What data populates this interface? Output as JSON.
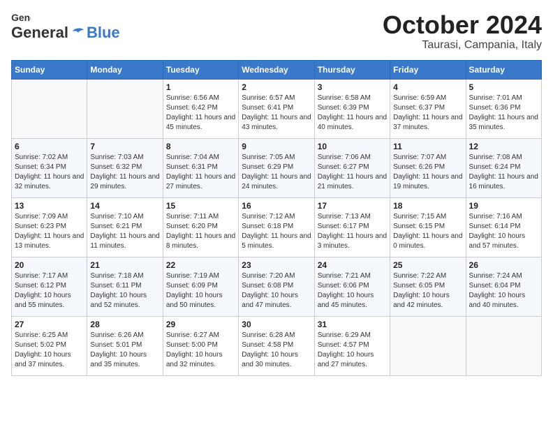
{
  "header": {
    "logo_general": "General",
    "logo_blue": "Blue",
    "month": "October 2024",
    "location": "Taurasi, Campania, Italy"
  },
  "weekdays": [
    "Sunday",
    "Monday",
    "Tuesday",
    "Wednesday",
    "Thursday",
    "Friday",
    "Saturday"
  ],
  "weeks": [
    [
      {
        "day": "",
        "details": ""
      },
      {
        "day": "",
        "details": ""
      },
      {
        "day": "1",
        "details": "Sunrise: 6:56 AM\nSunset: 6:42 PM\nDaylight: 11 hours and 45 minutes."
      },
      {
        "day": "2",
        "details": "Sunrise: 6:57 AM\nSunset: 6:41 PM\nDaylight: 11 hours and 43 minutes."
      },
      {
        "day": "3",
        "details": "Sunrise: 6:58 AM\nSunset: 6:39 PM\nDaylight: 11 hours and 40 minutes."
      },
      {
        "day": "4",
        "details": "Sunrise: 6:59 AM\nSunset: 6:37 PM\nDaylight: 11 hours and 37 minutes."
      },
      {
        "day": "5",
        "details": "Sunrise: 7:01 AM\nSunset: 6:36 PM\nDaylight: 11 hours and 35 minutes."
      }
    ],
    [
      {
        "day": "6",
        "details": "Sunrise: 7:02 AM\nSunset: 6:34 PM\nDaylight: 11 hours and 32 minutes."
      },
      {
        "day": "7",
        "details": "Sunrise: 7:03 AM\nSunset: 6:32 PM\nDaylight: 11 hours and 29 minutes."
      },
      {
        "day": "8",
        "details": "Sunrise: 7:04 AM\nSunset: 6:31 PM\nDaylight: 11 hours and 27 minutes."
      },
      {
        "day": "9",
        "details": "Sunrise: 7:05 AM\nSunset: 6:29 PM\nDaylight: 11 hours and 24 minutes."
      },
      {
        "day": "10",
        "details": "Sunrise: 7:06 AM\nSunset: 6:27 PM\nDaylight: 11 hours and 21 minutes."
      },
      {
        "day": "11",
        "details": "Sunrise: 7:07 AM\nSunset: 6:26 PM\nDaylight: 11 hours and 19 minutes."
      },
      {
        "day": "12",
        "details": "Sunrise: 7:08 AM\nSunset: 6:24 PM\nDaylight: 11 hours and 16 minutes."
      }
    ],
    [
      {
        "day": "13",
        "details": "Sunrise: 7:09 AM\nSunset: 6:23 PM\nDaylight: 11 hours and 13 minutes."
      },
      {
        "day": "14",
        "details": "Sunrise: 7:10 AM\nSunset: 6:21 PM\nDaylight: 11 hours and 11 minutes."
      },
      {
        "day": "15",
        "details": "Sunrise: 7:11 AM\nSunset: 6:20 PM\nDaylight: 11 hours and 8 minutes."
      },
      {
        "day": "16",
        "details": "Sunrise: 7:12 AM\nSunset: 6:18 PM\nDaylight: 11 hours and 5 minutes."
      },
      {
        "day": "17",
        "details": "Sunrise: 7:13 AM\nSunset: 6:17 PM\nDaylight: 11 hours and 3 minutes."
      },
      {
        "day": "18",
        "details": "Sunrise: 7:15 AM\nSunset: 6:15 PM\nDaylight: 11 hours and 0 minutes."
      },
      {
        "day": "19",
        "details": "Sunrise: 7:16 AM\nSunset: 6:14 PM\nDaylight: 10 hours and 57 minutes."
      }
    ],
    [
      {
        "day": "20",
        "details": "Sunrise: 7:17 AM\nSunset: 6:12 PM\nDaylight: 10 hours and 55 minutes."
      },
      {
        "day": "21",
        "details": "Sunrise: 7:18 AM\nSunset: 6:11 PM\nDaylight: 10 hours and 52 minutes."
      },
      {
        "day": "22",
        "details": "Sunrise: 7:19 AM\nSunset: 6:09 PM\nDaylight: 10 hours and 50 minutes."
      },
      {
        "day": "23",
        "details": "Sunrise: 7:20 AM\nSunset: 6:08 PM\nDaylight: 10 hours and 47 minutes."
      },
      {
        "day": "24",
        "details": "Sunrise: 7:21 AM\nSunset: 6:06 PM\nDaylight: 10 hours and 45 minutes."
      },
      {
        "day": "25",
        "details": "Sunrise: 7:22 AM\nSunset: 6:05 PM\nDaylight: 10 hours and 42 minutes."
      },
      {
        "day": "26",
        "details": "Sunrise: 7:24 AM\nSunset: 6:04 PM\nDaylight: 10 hours and 40 minutes."
      }
    ],
    [
      {
        "day": "27",
        "details": "Sunrise: 6:25 AM\nSunset: 5:02 PM\nDaylight: 10 hours and 37 minutes."
      },
      {
        "day": "28",
        "details": "Sunrise: 6:26 AM\nSunset: 5:01 PM\nDaylight: 10 hours and 35 minutes."
      },
      {
        "day": "29",
        "details": "Sunrise: 6:27 AM\nSunset: 5:00 PM\nDaylight: 10 hours and 32 minutes."
      },
      {
        "day": "30",
        "details": "Sunrise: 6:28 AM\nSunset: 4:58 PM\nDaylight: 10 hours and 30 minutes."
      },
      {
        "day": "31",
        "details": "Sunrise: 6:29 AM\nSunset: 4:57 PM\nDaylight: 10 hours and 27 minutes."
      },
      {
        "day": "",
        "details": ""
      },
      {
        "day": "",
        "details": ""
      }
    ]
  ]
}
